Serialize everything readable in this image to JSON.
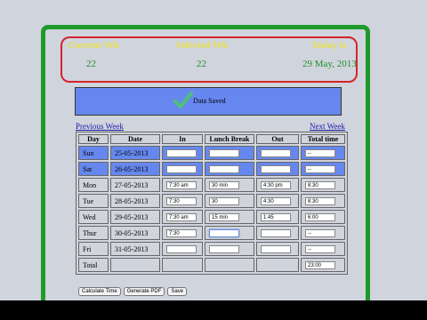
{
  "header": {
    "current_wk_label": "Current Wk",
    "selected_wk_label": "Selected Wk",
    "today_label": "Today is",
    "current_wk_value": "22",
    "selected_wk_value": "22",
    "today_value": "29 May, 2013"
  },
  "status": {
    "message": "Data Saved",
    "icon": "check-icon"
  },
  "nav": {
    "prev": "Previous Week",
    "next": "Next Week"
  },
  "table": {
    "headers": [
      "Day",
      "Date",
      "In",
      "Lunch Break",
      "Out",
      "Total time"
    ],
    "rows": [
      {
        "day": "Sun",
        "date": "25-05-2013",
        "in": "",
        "lunch": "",
        "out": "",
        "total": "--"
      },
      {
        "day": "Sat",
        "date": "26-05-2013",
        "in": "",
        "lunch": "",
        "out": "",
        "total": "--"
      },
      {
        "day": "Mon",
        "date": "27-05-2013",
        "in": "7:30 am",
        "lunch": "30 min",
        "out": "4:30 pm",
        "total": "8:30"
      },
      {
        "day": "Tue",
        "date": "28-05-2013",
        "in": "7:30",
        "lunch": "30",
        "out": "4:30",
        "total": "8:30"
      },
      {
        "day": "Wed",
        "date": "29-05-2013",
        "in": "7:30 am",
        "lunch": "15 min",
        "out": "1:45",
        "total": "6:00"
      },
      {
        "day": "Thur",
        "date": "30-05-2013",
        "in": "7:30",
        "lunch": "",
        "out": "",
        "total": "--"
      },
      {
        "day": "Fri",
        "date": "31-05-2013",
        "in": "",
        "lunch": "",
        "out": "",
        "total": "--"
      }
    ],
    "total_label": "Total",
    "total_value": "23:00"
  },
  "buttons": {
    "calculate": "Calculate Time",
    "pdf": "Generate PDF",
    "save": "Save"
  },
  "colors": {
    "accent": "#6688ee",
    "frame": "#1e9a2a",
    "header_border": "#d4242a"
  }
}
